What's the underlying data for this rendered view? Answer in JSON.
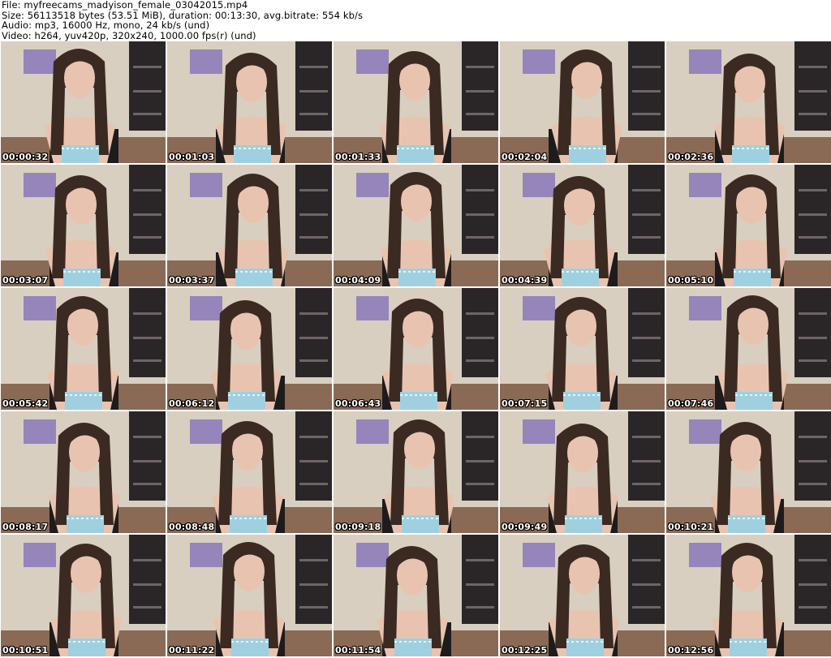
{
  "header": {
    "file": "File: myfreecams_madyison_female_03042015.mp4",
    "size": "Size: 56113518 bytes (53.51 MiB), duration: 00:13:30, avg.bitrate: 554 kb/s",
    "audio": "Audio: mp3, 16000 Hz, mono, 24 kb/s (und)",
    "video": "Video: h264, yuv420p, 320x240, 1000.00 fps(r) (und)"
  },
  "thumbnails": [
    {
      "timestamp": "00:00:32"
    },
    {
      "timestamp": "00:01:03"
    },
    {
      "timestamp": "00:01:33"
    },
    {
      "timestamp": "00:02:04"
    },
    {
      "timestamp": "00:02:36"
    },
    {
      "timestamp": "00:03:07"
    },
    {
      "timestamp": "00:03:37"
    },
    {
      "timestamp": "00:04:09"
    },
    {
      "timestamp": "00:04:39"
    },
    {
      "timestamp": "00:05:10"
    },
    {
      "timestamp": "00:05:42"
    },
    {
      "timestamp": "00:06:12"
    },
    {
      "timestamp": "00:06:43"
    },
    {
      "timestamp": "00:07:15"
    },
    {
      "timestamp": "00:07:46"
    },
    {
      "timestamp": "00:08:17"
    },
    {
      "timestamp": "00:08:48"
    },
    {
      "timestamp": "00:09:18"
    },
    {
      "timestamp": "00:09:49"
    },
    {
      "timestamp": "00:10:21"
    },
    {
      "timestamp": "00:10:51"
    },
    {
      "timestamp": "00:11:22"
    },
    {
      "timestamp": "00:11:54"
    },
    {
      "timestamp": "00:12:25"
    },
    {
      "timestamp": "00:12:56"
    }
  ],
  "colors": {
    "wall": "#d8cfc0",
    "floor": "#8a6a55",
    "shelf": "#2a2628",
    "hair": "#3b2a22",
    "skin": "#e8c4b0",
    "top": "#9fd0e0",
    "poster": "#8a78b8"
  }
}
